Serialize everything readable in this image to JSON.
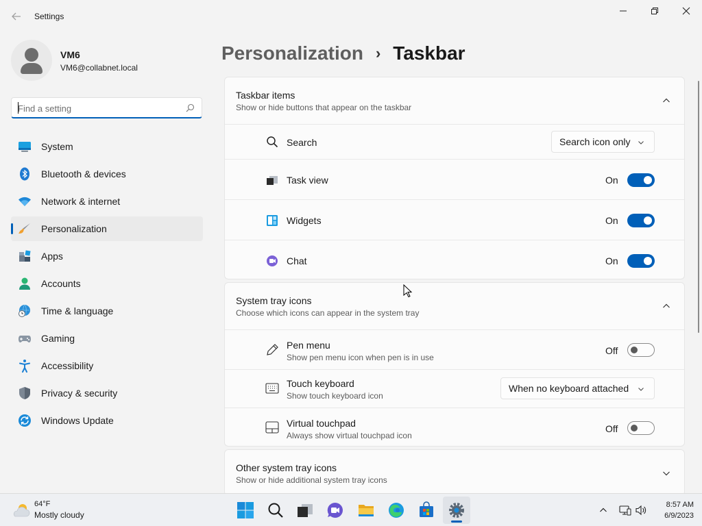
{
  "window": {
    "title": "Settings",
    "controls": [
      "minimize-icon",
      "maximize-icon",
      "close-icon"
    ]
  },
  "profile": {
    "name": "VM6",
    "email": "VM6@collabnet.local"
  },
  "search": {
    "placeholder": "Find a setting",
    "value": ""
  },
  "sidebar": {
    "items": [
      {
        "label": "System",
        "icon": "system-icon",
        "active": false
      },
      {
        "label": "Bluetooth & devices",
        "icon": "bluetooth-icon",
        "active": false
      },
      {
        "label": "Network & internet",
        "icon": "wifi-icon",
        "active": false
      },
      {
        "label": "Personalization",
        "icon": "brush-icon",
        "active": true
      },
      {
        "label": "Apps",
        "icon": "apps-icon",
        "active": false
      },
      {
        "label": "Accounts",
        "icon": "accounts-icon",
        "active": false
      },
      {
        "label": "Time & language",
        "icon": "globe-clock-icon",
        "active": false
      },
      {
        "label": "Gaming",
        "icon": "gamepad-icon",
        "active": false
      },
      {
        "label": "Accessibility",
        "icon": "accessibility-icon",
        "active": false
      },
      {
        "label": "Privacy & security",
        "icon": "shield-icon",
        "active": false
      },
      {
        "label": "Windows Update",
        "icon": "update-icon",
        "active": false
      }
    ]
  },
  "breadcrumb": {
    "parent": "Personalization",
    "separator": "›",
    "current": "Taskbar"
  },
  "sections": {
    "taskbar_items": {
      "title": "Taskbar items",
      "subtitle": "Show or hide buttons that appear on the taskbar",
      "expanded": true,
      "rows": [
        {
          "label": "Search",
          "icon": "search-icon",
          "control": "dropdown",
          "value": "Search icon only"
        },
        {
          "label": "Task view",
          "icon": "task-view-icon",
          "control": "toggle",
          "state": "On",
          "on": true
        },
        {
          "label": "Widgets",
          "icon": "widgets-icon",
          "control": "toggle",
          "state": "On",
          "on": true
        },
        {
          "label": "Chat",
          "icon": "chat-icon",
          "control": "toggle",
          "state": "On",
          "on": true
        }
      ]
    },
    "system_tray_icons": {
      "title": "System tray icons",
      "subtitle": "Choose which icons can appear in the system tray",
      "expanded": true,
      "rows": [
        {
          "label": "Pen menu",
          "sublabel": "Show pen menu icon when pen is in use",
          "icon": "pen-icon",
          "control": "toggle",
          "state": "Off",
          "on": false
        },
        {
          "label": "Touch keyboard",
          "sublabel": "Show touch keyboard icon",
          "icon": "keyboard-icon",
          "control": "dropdown",
          "value": "When no keyboard attached"
        },
        {
          "label": "Virtual touchpad",
          "sublabel": "Always show virtual touchpad icon",
          "icon": "touchpad-icon",
          "control": "toggle",
          "state": "Off",
          "on": false
        }
      ]
    },
    "other_tray_icons": {
      "title": "Other system tray icons",
      "subtitle": "Show or hide additional system tray icons",
      "expanded": false
    }
  },
  "taskbar": {
    "weather": {
      "temp": "64°F",
      "desc": "Mostly cloudy"
    },
    "apps": [
      "start-icon",
      "search-icon",
      "task-view-icon",
      "chat-icon",
      "file-explorer-icon",
      "edge-icon",
      "store-icon",
      "settings-icon"
    ],
    "active_app": "settings-icon",
    "tray": [
      "chevron-up-icon",
      "network-icon",
      "volume-icon"
    ],
    "clock": {
      "time": "8:57 AM",
      "date": "6/9/2023"
    }
  },
  "colors": {
    "accent": "#005fb8",
    "background": "#f3f3f3",
    "card": "#fbfbfb"
  }
}
